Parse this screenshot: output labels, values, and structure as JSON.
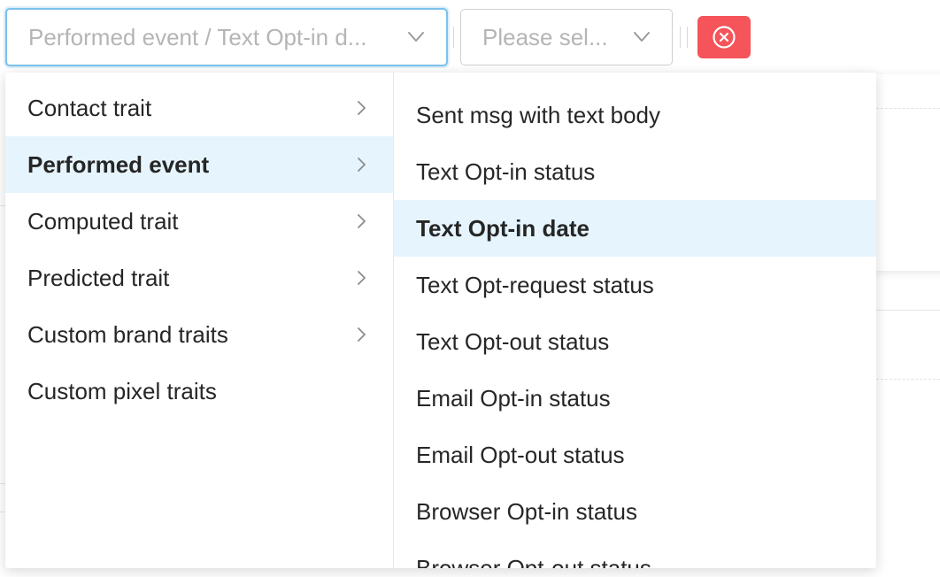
{
  "toolbar": {
    "primary_select": {
      "value": "Performed event / Text Opt-in d...",
      "icon": "chevron-down-icon"
    },
    "secondary_select": {
      "placeholder": "Please sel...",
      "icon": "chevron-down-icon"
    },
    "clear_button": {
      "icon": "close-circle-icon",
      "color": "#f4545a"
    }
  },
  "dropdown": {
    "categories": [
      {
        "label": "Contact trait",
        "has_submenu": true,
        "active": false
      },
      {
        "label": "Performed event",
        "has_submenu": true,
        "active": true
      },
      {
        "label": "Computed trait",
        "has_submenu": true,
        "active": false
      },
      {
        "label": "Predicted trait",
        "has_submenu": true,
        "active": false
      },
      {
        "label": "Custom brand traits",
        "has_submenu": true,
        "active": false
      },
      {
        "label": "Custom pixel traits",
        "has_submenu": false,
        "active": false
      }
    ],
    "events": [
      {
        "label": "Sent msg with text body",
        "active": false
      },
      {
        "label": "Text Opt-in status",
        "active": false
      },
      {
        "label": "Text Opt-in date",
        "active": true
      },
      {
        "label": "Text Opt-request status",
        "active": false
      },
      {
        "label": "Text Opt-out status",
        "active": false
      },
      {
        "label": "Email Opt-in status",
        "active": false
      },
      {
        "label": "Email Opt-out status",
        "active": false
      },
      {
        "label": "Browser Opt-in status",
        "active": false
      },
      {
        "label": "Browser Opt-out status",
        "active": false
      }
    ],
    "colors": {
      "active_background": "#e6f5fd",
      "focus_border": "#7cc1ec"
    }
  }
}
